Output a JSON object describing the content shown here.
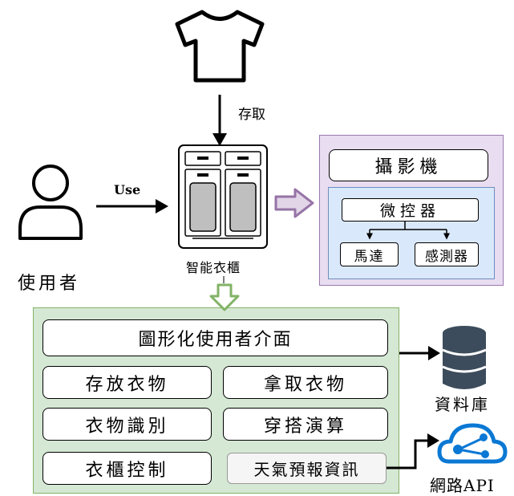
{
  "labels": {
    "store_access": "存取",
    "use": "Use",
    "user": "使用者",
    "smart_wardrobe": "智能衣櫃",
    "database": "資料庫",
    "network_api": "網路API"
  },
  "hardware": {
    "camera": "攝影機",
    "microcontroller": "微控器",
    "motor": "馬達",
    "sensor": "感測器"
  },
  "software": {
    "gui": "圖形化使用者介面",
    "store_clothes": "存放衣物",
    "take_clothes": "拿取衣物",
    "clothes_recognition": "衣物識別",
    "outfit_algorithm": "穿搭演算",
    "wardrobe_control": "衣櫃控制",
    "weather_info": "天氣預報資訊"
  },
  "colors": {
    "hardware_panel_fill": "#e9ddf1",
    "hardware_panel_border": "#9a79b0",
    "controller_panel_fill": "#dae8fc",
    "controller_panel_border": "#6c8ebf",
    "software_panel_fill": "#d5e8d4",
    "software_panel_border": "#82b366",
    "purple_arrow_fill": "#e1d5e7",
    "purple_arrow_stroke": "#9673a6",
    "green_arrow_fill": "#ffffff",
    "green_arrow_stroke": "#82b366",
    "weather_box_fill": "#f5f5f5",
    "database_fill": "#3c4c5c",
    "cloud_color": "#0a78d4"
  },
  "icons": [
    "tshirt-icon",
    "user-icon",
    "wardrobe-icon",
    "database-icon",
    "cloud-api-icon"
  ]
}
